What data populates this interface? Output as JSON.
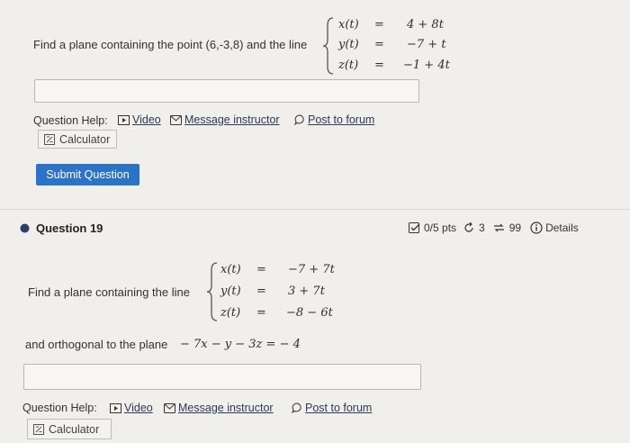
{
  "q18": {
    "prompt": "Find a plane containing the point (6,-3,8) and the line",
    "system": {
      "rows": [
        {
          "lhs": "x(t)",
          "eq": "=",
          "rhs": "4 + 8t"
        },
        {
          "lhs": "y(t)",
          "eq": "=",
          "rhs": "−7 + t"
        },
        {
          "lhs": "z(t)",
          "eq": "=",
          "rhs": "−1 + 4t"
        }
      ]
    },
    "answer_value": "",
    "help": {
      "label": "Question Help:",
      "video": "Video",
      "message": "Message instructor",
      "forum": "Post to forum",
      "calculator": "Calculator"
    },
    "submit": "Submit Question"
  },
  "q19": {
    "title": "Question 19",
    "points": "0/5 pts",
    "retries": "3",
    "attempts": "99",
    "details": "Details",
    "prompt": "Find a plane containing the line",
    "system": {
      "rows": [
        {
          "lhs": "x(t)",
          "eq": "=",
          "rhs": "−7 + 7t"
        },
        {
          "lhs": "y(t)",
          "eq": "=",
          "rhs": "3 + 7t"
        },
        {
          "lhs": "z(t)",
          "eq": "=",
          "rhs": "−8 − 6t"
        }
      ]
    },
    "prompt2": "and orthogonal to the plane",
    "plane_eq": "− 7x − y − 3z = − 4",
    "answer_value": "",
    "help": {
      "label": "Question Help:",
      "video": "Video",
      "message": "Message instructor",
      "forum": "Post to forum",
      "calculator": "Calculator"
    }
  },
  "colors": {
    "background": "#f1efec",
    "submit": "#2c72c7",
    "bullet": "#2b3d6b",
    "link": "#2b3a55"
  }
}
